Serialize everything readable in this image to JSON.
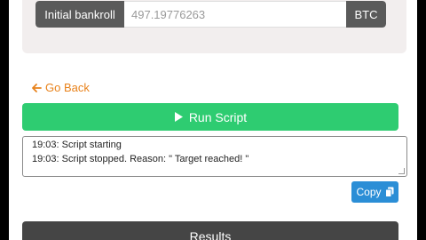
{
  "bankroll": {
    "label": "Initial bankroll",
    "value": "497.19776263",
    "currency": "BTC"
  },
  "nav": {
    "back_label": "Go Back",
    "back_icon": "arrow-left-icon"
  },
  "actions": {
    "run_label": "Run Script",
    "run_icon": "play-icon",
    "copy_label": "Copy",
    "copy_icon": "copy-icon"
  },
  "log": {
    "lines": [
      "19:03: Script starting",
      "19:03: Script stopped. Reason: \" Target reached! \""
    ]
  },
  "results": {
    "title": "Results"
  },
  "colors": {
    "run_button": "#2ecc71",
    "copy_button": "#2b8ed6",
    "back_link": "#e8821b",
    "results_bar": "#454545",
    "addon": "#5a5a5a"
  }
}
